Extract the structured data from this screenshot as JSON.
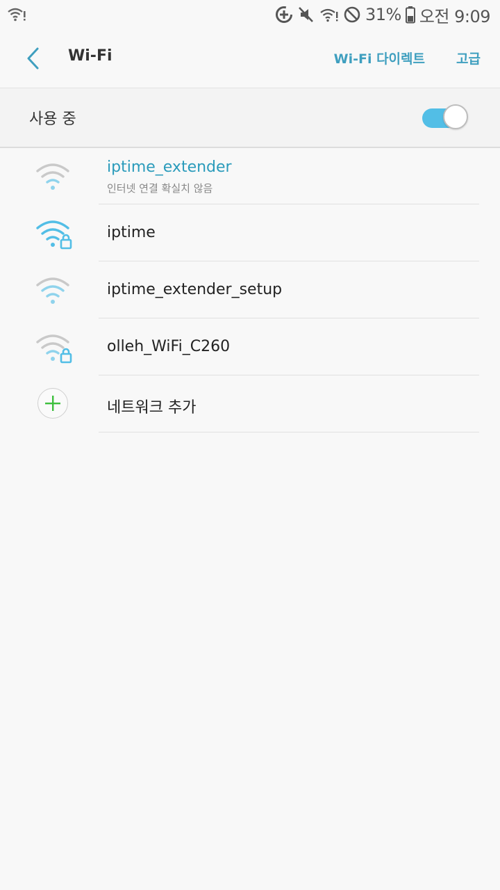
{
  "status_bar": {
    "battery_percent": "31%",
    "time": "오전 9:09"
  },
  "header": {
    "title": "Wi-Fi",
    "action_direct": "Wi-Fi 다이렉트",
    "action_advanced": "고급"
  },
  "master_switch": {
    "label": "사용 중",
    "on": true
  },
  "networks": [
    {
      "name": "iptime_extender",
      "status": "인터넷 연결 확실치 않음",
      "secured": false,
      "connected": true
    },
    {
      "name": "iptime",
      "status": "",
      "secured": true,
      "connected": false
    },
    {
      "name": "iptime_extender_setup",
      "status": "",
      "secured": false,
      "connected": false
    },
    {
      "name": "olleh_WiFi_C260",
      "status": "",
      "secured": true,
      "connected": false
    }
  ],
  "add_network": {
    "label": "네트워크 추가"
  },
  "colors": {
    "accent": "#3f9fbf",
    "connected_text": "#2a9bbb",
    "toggle_on": "#52bee6",
    "plus_green": "#3cbf3c"
  }
}
